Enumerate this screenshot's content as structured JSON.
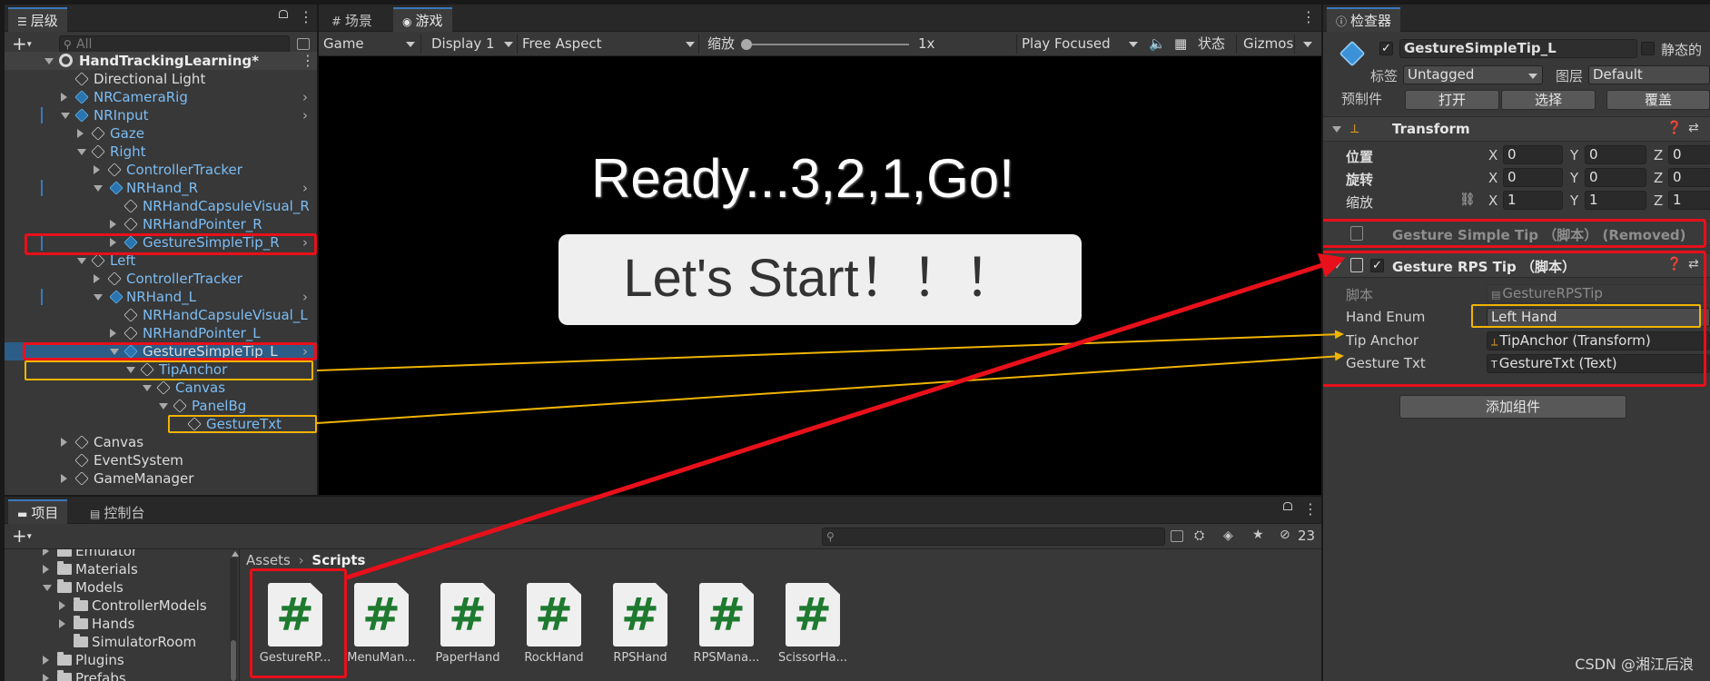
{
  "hierarchy": {
    "tab_label": "层级",
    "search_placeholder": "All",
    "rows": [
      {
        "label": "HandTrackingLearning*"
      },
      {
        "label": "Directional Light"
      },
      {
        "label": "NRCameraRig"
      },
      {
        "label": "NRInput"
      },
      {
        "label": "Gaze"
      },
      {
        "label": "Right"
      },
      {
        "label": "ControllerTracker"
      },
      {
        "label": "NRHand_R"
      },
      {
        "label": "NRHandCapsuleVisual_R"
      },
      {
        "label": "NRHandPointer_R"
      },
      {
        "label": "GestureSimpleTip_R"
      },
      {
        "label": "Left"
      },
      {
        "label": "ControllerTracker"
      },
      {
        "label": "NRHand_L"
      },
      {
        "label": "NRHandCapsuleVisual_L"
      },
      {
        "label": "NRHandPointer_L"
      },
      {
        "label": "GestureSimpleTip_L"
      },
      {
        "label": "TipAnchor"
      },
      {
        "label": "Canvas"
      },
      {
        "label": "PanelBg"
      },
      {
        "label": "GestureTxt"
      },
      {
        "label": "Canvas"
      },
      {
        "label": "EventSystem"
      },
      {
        "label": "GameManager"
      }
    ]
  },
  "game": {
    "tab_scene": "场景",
    "tab_game": "游戏",
    "game_dropdown": "Game",
    "display_dropdown": "Display 1",
    "aspect_dropdown": "Free Aspect",
    "scale_label": "缩放",
    "scale_value": "1x",
    "play_mode": "Play Focused",
    "stats_label": "状态",
    "gizmos_label": "Gizmos",
    "ready_text": "Ready...3,2,1,Go!",
    "start_button": "Let's Start！！！"
  },
  "inspector": {
    "tab_label": "检查器",
    "object_name": "GestureSimpleTip_L",
    "static_label": "静态的",
    "tag_label": "标签",
    "tag_value": "Untagged",
    "layer_label": "图层",
    "layer_value": "Default",
    "prefab_label": "预制件",
    "prefab_open": "打开",
    "prefab_select": "选择",
    "prefab_override": "覆盖",
    "transform": {
      "title": "Transform",
      "position_label": "位置",
      "rotation_label": "旋转",
      "scale_label": "缩放",
      "position": {
        "x": "0",
        "y": "0",
        "z": "0"
      },
      "rotation": {
        "x": "0",
        "y": "0",
        "z": "0"
      },
      "scale": {
        "x": "1",
        "y": "1",
        "z": "1"
      }
    },
    "removed_component": "Gesture Simple Tip （脚本） (Removed)",
    "rps_component": {
      "title": "Gesture RPS Tip （脚本）",
      "script_label": "脚本",
      "script_value": "GestureRPSTip",
      "hand_enum_label": "Hand Enum",
      "hand_enum_value": "Left Hand",
      "tip_anchor_label": "Tip Anchor",
      "tip_anchor_value": "TipAnchor (Transform)",
      "gesture_txt_label": "Gesture Txt",
      "gesture_txt_value": "GestureTxt (Text)"
    },
    "add_component": "添加组件"
  },
  "project": {
    "tab_project": "项目",
    "tab_console": "控制台",
    "hidden_count": "23",
    "breadcrumb_root": "Assets",
    "breadcrumb_current": "Scripts",
    "tree": [
      {
        "label": "Emulator"
      },
      {
        "label": "Materials"
      },
      {
        "label": "Models"
      },
      {
        "label": "ControllerModels"
      },
      {
        "label": "Hands"
      },
      {
        "label": "SimulatorRoom"
      },
      {
        "label": "Plugins"
      },
      {
        "label": "Prefabs"
      }
    ],
    "assets": [
      {
        "name": "GestureRP..."
      },
      {
        "name": "MenuMan..."
      },
      {
        "name": "PaperHand"
      },
      {
        "name": "RockHand"
      },
      {
        "name": "RPSHand"
      },
      {
        "name": "RPSMana..."
      },
      {
        "name": "ScissorHa..."
      }
    ]
  },
  "watermark": "CSDN @湘江后浪",
  "colors": {
    "highlight_red": "#e8101a",
    "highlight_yellow": "#f0b400",
    "selection_blue": "#3a79bb",
    "script_green": "#1e7a2f"
  }
}
